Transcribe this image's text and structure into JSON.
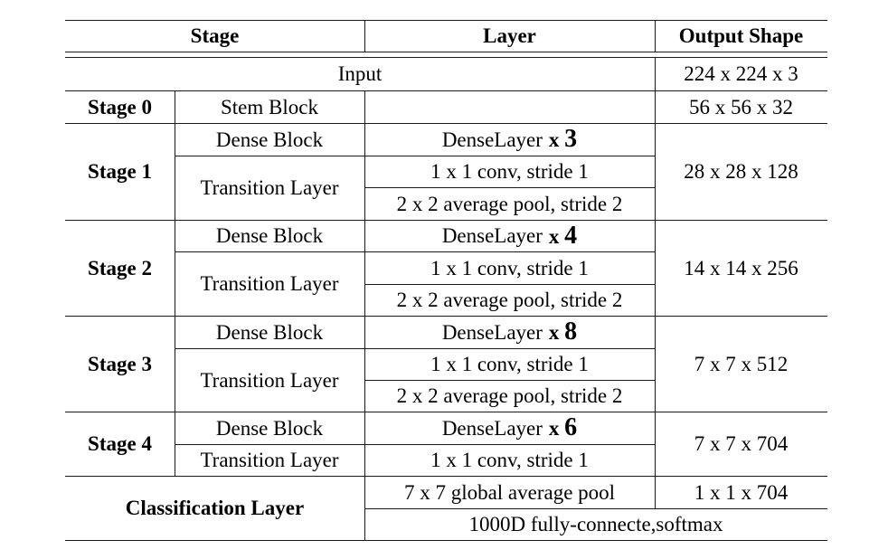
{
  "table": {
    "headers": {
      "stage": "Stage",
      "layer": "Layer",
      "output": "Output Shape"
    },
    "input": {
      "label": "Input",
      "output": "224 x 224 x 3"
    },
    "stage0": {
      "stage": "Stage 0",
      "block": "Stem Block",
      "layer": "",
      "output": "56 x 56 x 32"
    },
    "stages": [
      {
        "stage": "Stage 1",
        "dense_block": "Dense Block",
        "dense_layer": "DenseLayer",
        "x": "x",
        "repeat": "3",
        "transition": "Transition Layer",
        "conv": "1 x 1 conv, stride 1",
        "pool": "2 x 2 average pool, stride 2",
        "output": "28 x 28 x 128"
      },
      {
        "stage": "Stage 2",
        "dense_block": "Dense Block",
        "dense_layer": "DenseLayer",
        "x": "x",
        "repeat": "4",
        "transition": "Transition Layer",
        "conv": "1 x 1 conv, stride 1",
        "pool": "2 x 2 average pool, stride 2",
        "output": "14 x 14 x 256"
      },
      {
        "stage": "Stage 3",
        "dense_block": "Dense Block",
        "dense_layer": "DenseLayer",
        "x": "x",
        "repeat": "8",
        "transition": "Transition Layer",
        "conv": "1 x 1 conv, stride 1",
        "pool": "2 x 2 average pool, stride 2",
        "output": "7 x 7 x 512"
      },
      {
        "stage": "Stage 4",
        "dense_block": "Dense Block",
        "dense_layer": "DenseLayer",
        "x": "x",
        "repeat": "6",
        "transition": "Transition Layer",
        "conv": "1 x 1 conv, stride 1",
        "output": "7 x 7 x 704"
      }
    ],
    "classification": {
      "label": "Classification Layer",
      "pool": "7 x 7 global average pool",
      "pool_output": "1 x 1 x 704",
      "fc": "1000D fully-connecte,softmax"
    }
  }
}
